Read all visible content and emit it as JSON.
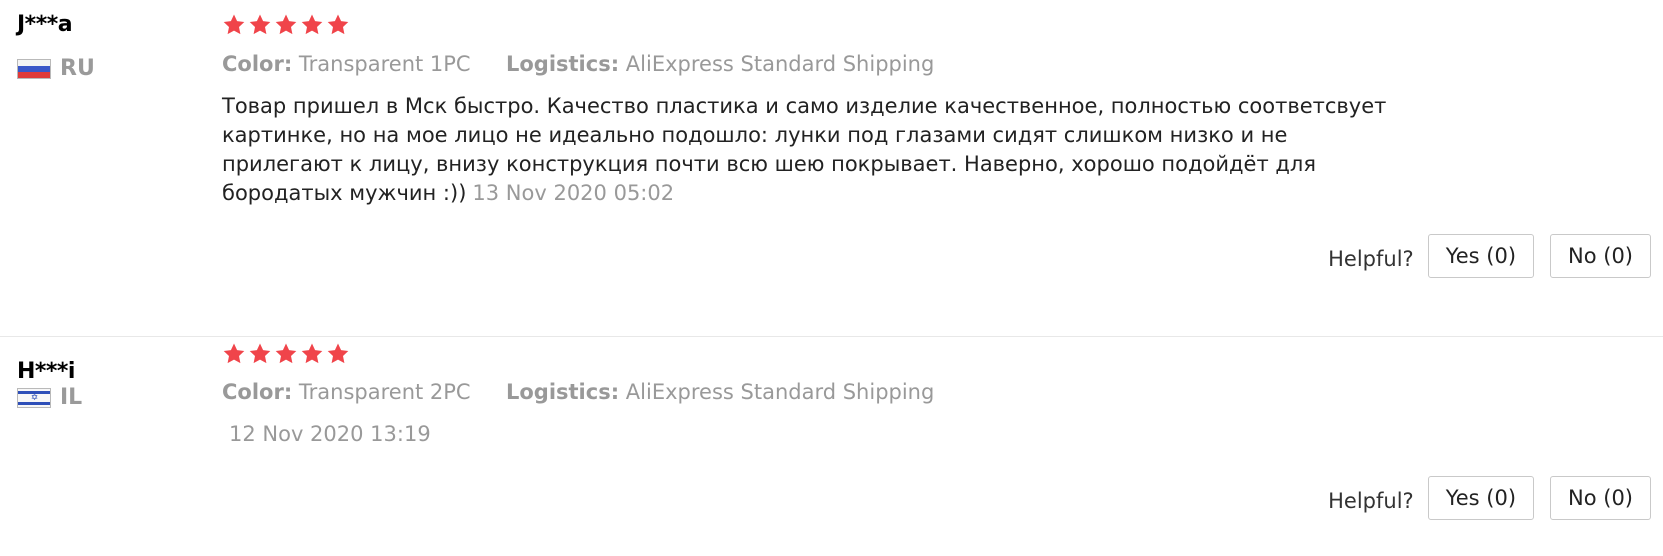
{
  "reviews": [
    {
      "user": "J***a",
      "country": "RU",
      "rating": 5,
      "color_label": "Color:",
      "color_value": "Transparent 1PC",
      "logistics_label": "Logistics:",
      "logistics_value": "AliExpress Standard Shipping",
      "text": "Товар пришел в Мск быстро. Качество пластика и само изделие качественное, полностью соответсвует картинке, но на мое лицо не идеально подошло: лунки под глазами сидят слишком низко и не прилегают к лицу, внизу конструкция почти всю шею покрывает. Наверно, хорошо подойдёт для бородатых мужчин :))",
      "date": "13 Nov 2020 05:02",
      "helpful_label": "Helpful?",
      "yes_label": "Yes (0)",
      "no_label": "No (0)"
    },
    {
      "user": "H***i",
      "country": "IL",
      "rating": 5,
      "color_label": "Color:",
      "color_value": "Transparent 2PC",
      "logistics_label": "Logistics:",
      "logistics_value": "AliExpress Standard Shipping",
      "text": "",
      "date": "12 Nov 2020 13:19",
      "helpful_label": "Helpful?",
      "yes_label": "Yes (0)",
      "no_label": "No (0)"
    }
  ],
  "colors": {
    "star": "#f0444a",
    "muted_text": "#999999",
    "body_text": "#222222"
  }
}
